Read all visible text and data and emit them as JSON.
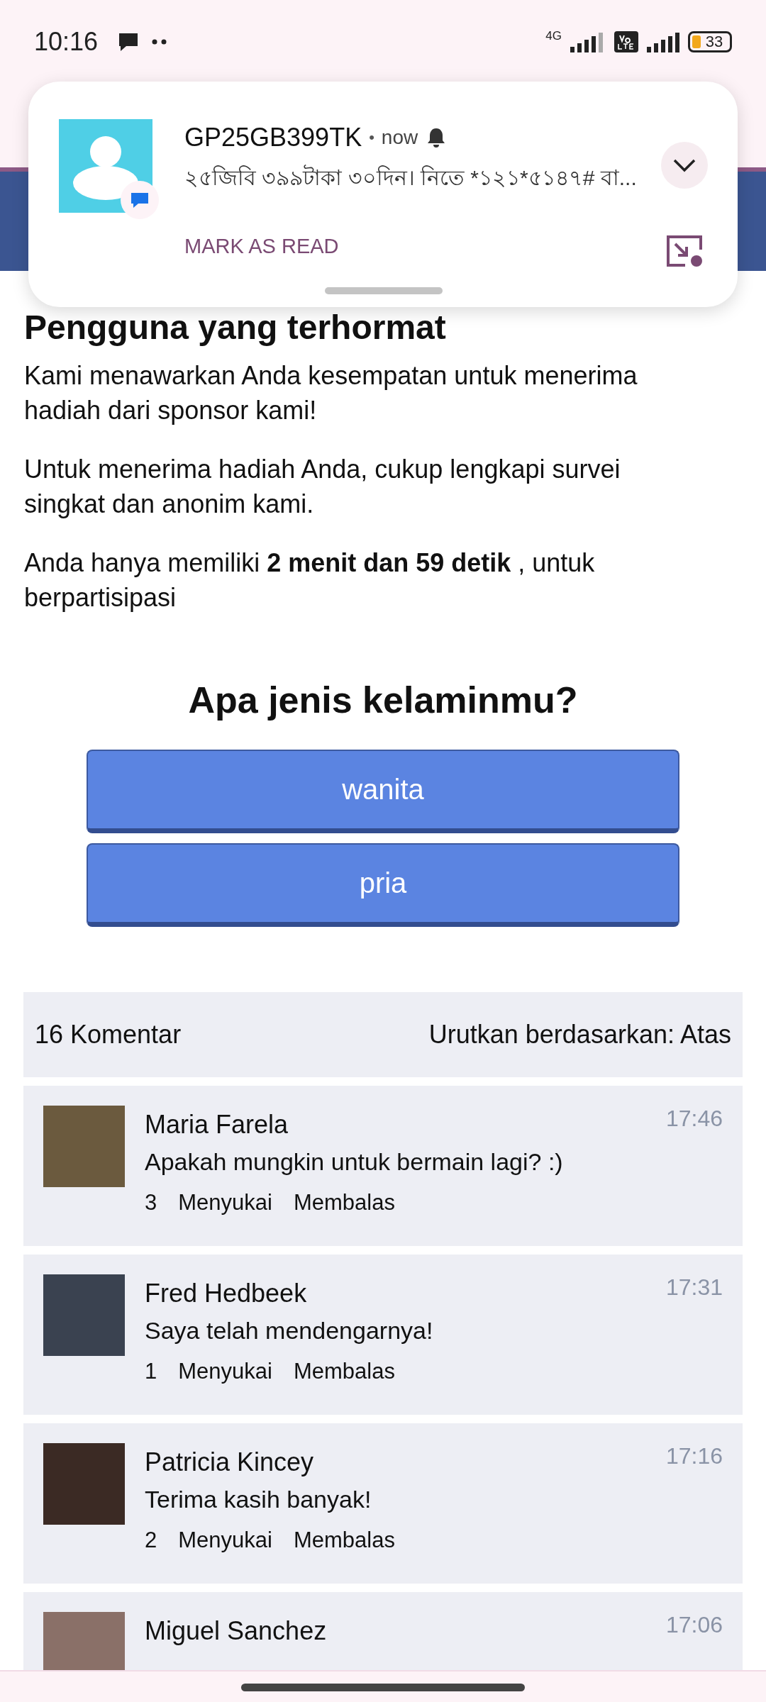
{
  "status_bar": {
    "time": "10:16",
    "network": "4G",
    "battery": "33"
  },
  "notification": {
    "sender": "GP25GB399TK",
    "separator": "•",
    "time": "now",
    "message": "২৫জিবি ৩৯৯টাকা ৩০দিন। নিতে *১২১*৫১৪৭# বা...",
    "action": "MARK AS READ"
  },
  "article": {
    "heading": "Pengguna yang terhormat",
    "paragraphs": [
      "Kami menawarkan Anda kesempatan untuk menerima hadiah dari sponsor kami!",
      "Untuk menerima hadiah Anda, cukup lengkapi survei singkat dan anonim kami.",
      "Anda hanya memiliki **2 menit dan 59 detik** , untuk berpartisipasi"
    ]
  },
  "survey": {
    "question": "Apa jenis kelaminmu?",
    "options": [
      "wanita",
      "pria"
    ]
  },
  "comments_header": {
    "count": "16 Komentar",
    "sort": "Urutkan berdasarkan: Atas"
  },
  "comments": [
    {
      "name": "Maria Farela",
      "time": "17:46",
      "text": "Apakah mungkin untuk bermain lagi? :)",
      "likes": "3",
      "like_label": "Menyukai",
      "reply_label": "Membalas"
    },
    {
      "name": "Fred Hedbeek",
      "time": "17:31",
      "text": "Saya telah mendengarnya!",
      "likes": "1",
      "like_label": "Menyukai",
      "reply_label": "Membalas"
    },
    {
      "name": "Patricia Kincey",
      "time": "17:16",
      "text": "Terima kasih banyak!",
      "likes": "2",
      "like_label": "Menyukai",
      "reply_label": "Membalas"
    },
    {
      "name": "Miguel Sanchez",
      "time": "17:06"
    }
  ]
}
